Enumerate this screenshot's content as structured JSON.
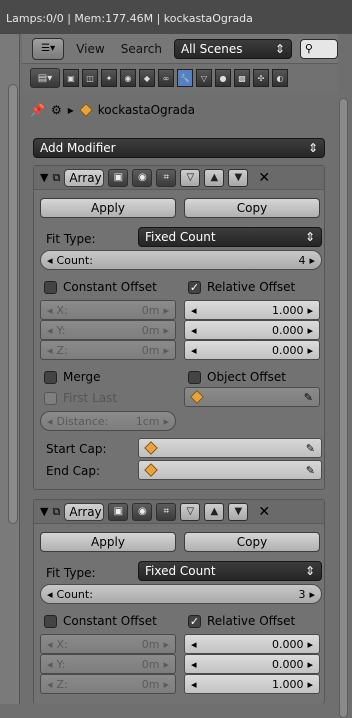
{
  "status_bar": {
    "text": "Lamps:0/0 | Mem:177.46M | kockastaOgrada"
  },
  "header": {
    "view_label": "View",
    "search_label": "Search",
    "scene_filter": "All Scenes"
  },
  "breadcrumb": {
    "object_name": "kockastaOgrada"
  },
  "add_modifier": "Add Modifier",
  "modifiers": [
    {
      "name": "Array",
      "apply": "Apply",
      "copy": "Copy",
      "fit_type_label": "Fit Type:",
      "fit_type_value": "Fixed Count",
      "count_label": "Count:",
      "count_value": "4",
      "constant_offset": "Constant Offset",
      "relative_offset": "Relative Offset",
      "const": {
        "x_label": "X:",
        "x": "0m",
        "y_label": "Y:",
        "y": "0m",
        "z_label": "Z:",
        "z": "0m"
      },
      "rel": {
        "x": "1.000",
        "y": "0.000",
        "z": "0.000"
      },
      "merge": "Merge",
      "object_offset": "Object Offset",
      "first_last": "First Last",
      "distance_label": "Distance:",
      "distance_value": "1cm",
      "start_cap": "Start Cap:",
      "end_cap": "End Cap:"
    },
    {
      "name": "Array",
      "apply": "Apply",
      "copy": "Copy",
      "fit_type_label": "Fit Type:",
      "fit_type_value": "Fixed Count",
      "count_label": "Count:",
      "count_value": "3",
      "constant_offset": "Constant Offset",
      "relative_offset": "Relative Offset",
      "const": {
        "x_label": "X:",
        "x": "0m",
        "y_label": "Y:",
        "y": "0m",
        "z_label": "Z:",
        "z": "0m"
      },
      "rel": {
        "x": "0.000",
        "y": "0.000",
        "z": "1.000"
      }
    }
  ],
  "colors": {
    "active_context": "#5680c2",
    "object_icon": "#e9a33a"
  }
}
